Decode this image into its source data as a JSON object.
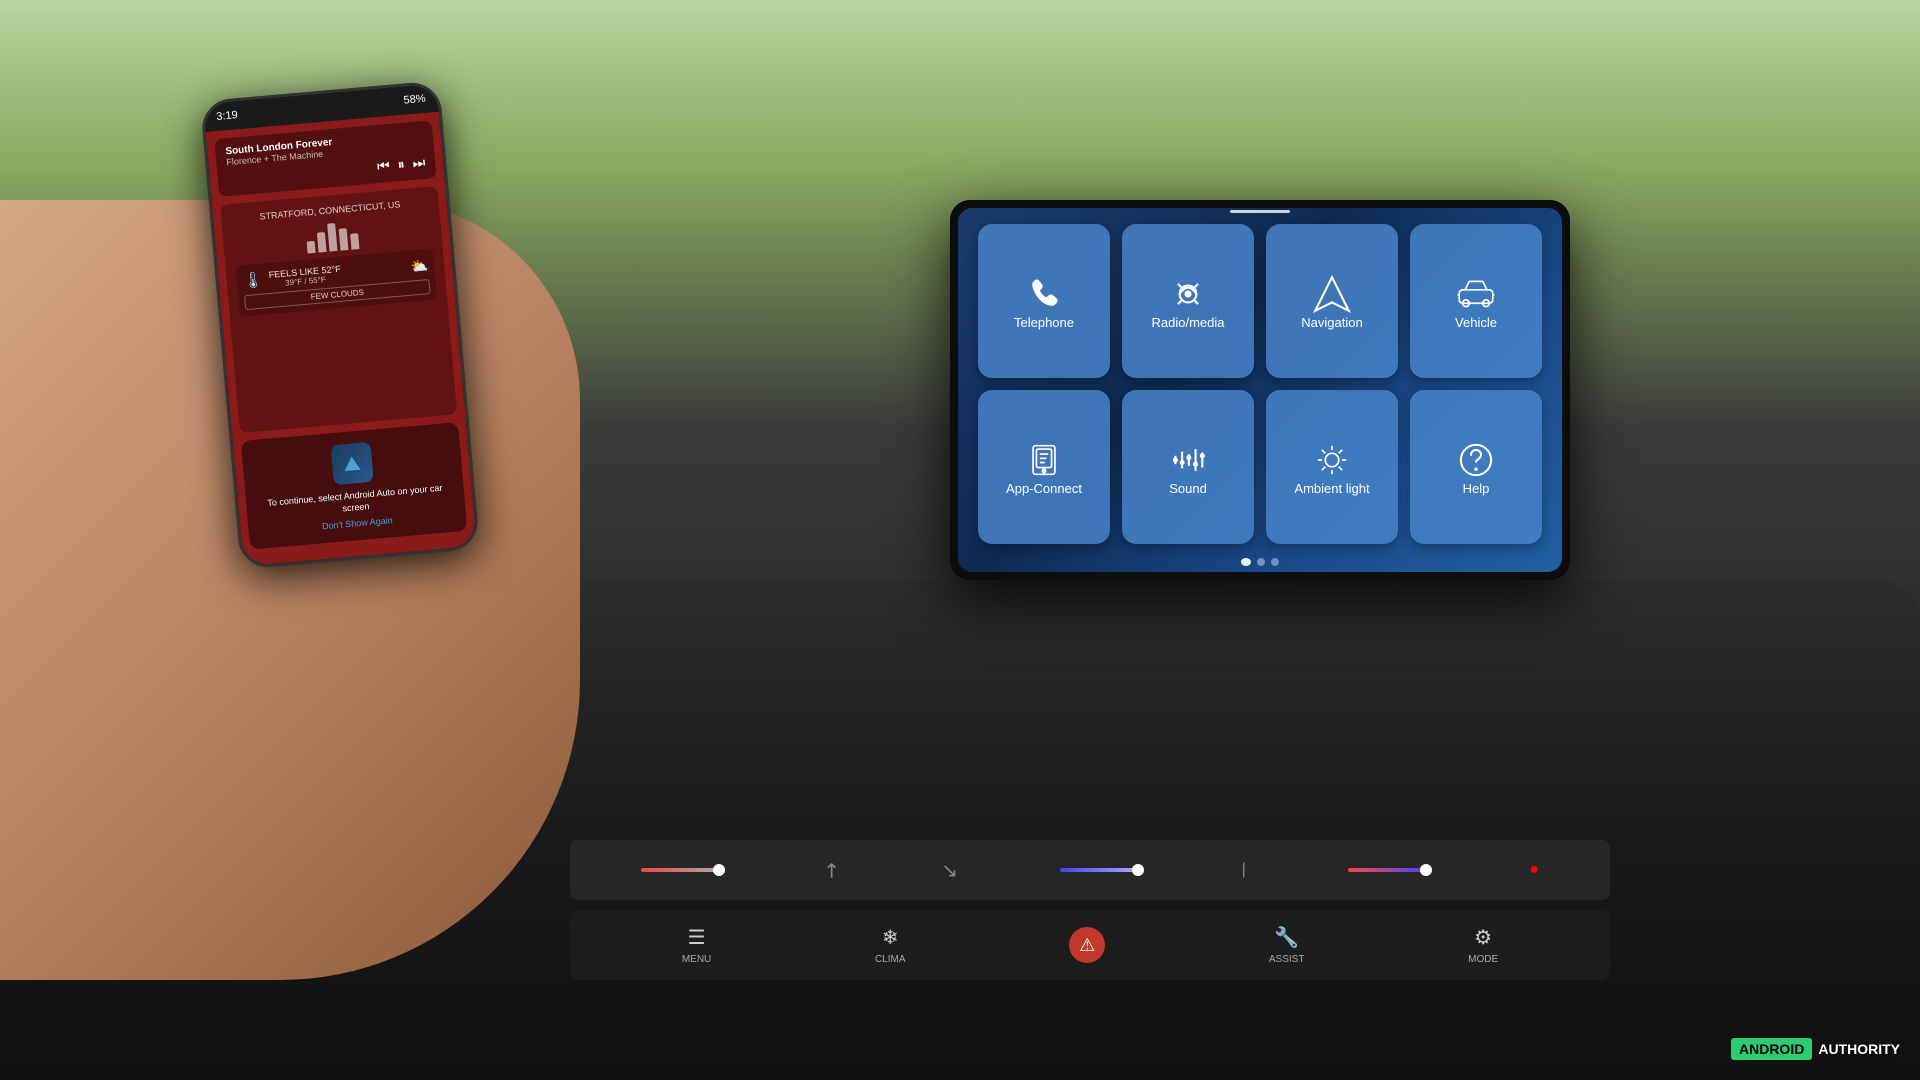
{
  "scene": {
    "background_desc": "Car interior with dashboard"
  },
  "phone": {
    "status_bar": {
      "time": "3:19",
      "battery": "58%"
    },
    "music": {
      "title": "South London Forever",
      "subtitle": "Florence + The Machine"
    },
    "weather": {
      "location": "STRATFORD, CONNECTICUT, US",
      "feels_like": "FEELS LIKE 52°F",
      "temp": "39°F / 55°F",
      "condition": "FEW CLOUDS"
    },
    "android_auto": {
      "message": "To continue, select Android Auto on your car screen",
      "link": "Don't Show Again"
    }
  },
  "car_screen": {
    "menu_items": [
      {
        "id": "telephone",
        "label": "Telephone",
        "icon": "phone"
      },
      {
        "id": "radio_media",
        "label": "Radio/media",
        "icon": "music"
      },
      {
        "id": "navigation",
        "label": "Navigation",
        "icon": "navigation"
      },
      {
        "id": "vehicle",
        "label": "Vehicle",
        "icon": "car"
      },
      {
        "id": "app_connect",
        "label": "App-Connect",
        "icon": "app"
      },
      {
        "id": "sound",
        "label": "Sound",
        "icon": "sound"
      },
      {
        "id": "ambient_light",
        "label": "Ambient light",
        "icon": "light"
      },
      {
        "id": "help",
        "label": "Help",
        "icon": "help"
      }
    ],
    "dots": [
      {
        "active": true
      },
      {
        "active": false
      },
      {
        "active": false
      }
    ]
  },
  "bottom_controls": {
    "buttons": [
      {
        "id": "menu",
        "label": "MENU",
        "icon": "☰"
      },
      {
        "id": "clima",
        "label": "CLIMA",
        "icon": "❄"
      },
      {
        "id": "hazard",
        "label": "",
        "icon": "⚠"
      },
      {
        "id": "assist",
        "label": "ASSIST",
        "icon": "🔧"
      },
      {
        "id": "mode",
        "label": "MODE",
        "icon": "⚙"
      }
    ]
  },
  "watermark": {
    "android": "ANDROID",
    "authority": "AUTHORITY"
  }
}
